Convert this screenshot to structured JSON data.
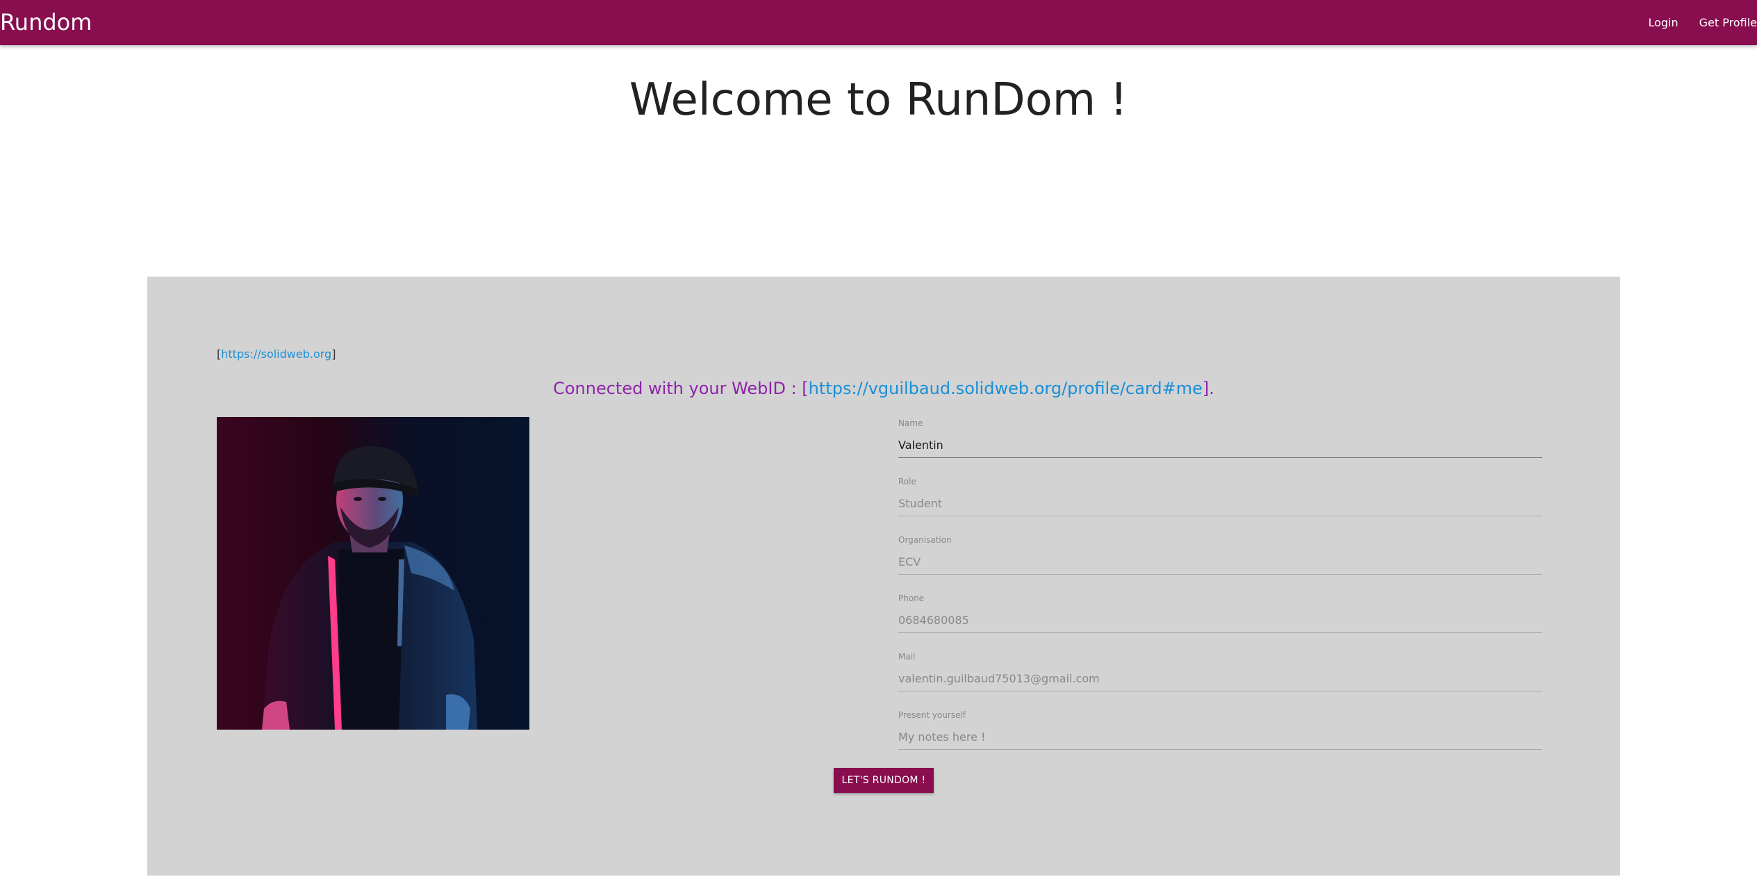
{
  "navbar": {
    "brand": "Rundom",
    "links": [
      "Login",
      "Get Profile"
    ],
    "color": "#880e4f"
  },
  "page": {
    "title": "Welcome to RunDom !"
  },
  "provider": {
    "open": "[",
    "url": "https://solidweb.org",
    "close": "]"
  },
  "webid": {
    "prefix": "Connected with your WebID : [",
    "url": "https://vguilbaud.solidweb.org/profile/card#me",
    "suffix": "]."
  },
  "profile_photo": {
    "icon": "profile-photo"
  },
  "form": {
    "fields": [
      {
        "label": "Name",
        "value": "Valentin",
        "placeholder": ""
      },
      {
        "label": "Role",
        "value": "",
        "placeholder": "Student"
      },
      {
        "label": "Organisation",
        "value": "",
        "placeholder": "ECV"
      },
      {
        "label": "Phone",
        "value": "",
        "placeholder": "0684680085"
      },
      {
        "label": "Mail",
        "value": "",
        "placeholder": "valentin.guilbaud75013@gmail.com"
      },
      {
        "label": "Present yourself",
        "value": "",
        "placeholder": "My notes here !"
      }
    ],
    "submit_label": "LET'S RUNDOM !"
  },
  "colors": {
    "primary": "#880e4f",
    "link": "#1a8fd8",
    "webid_text": "#8e24aa",
    "card_bg": "#d3d3d3"
  }
}
